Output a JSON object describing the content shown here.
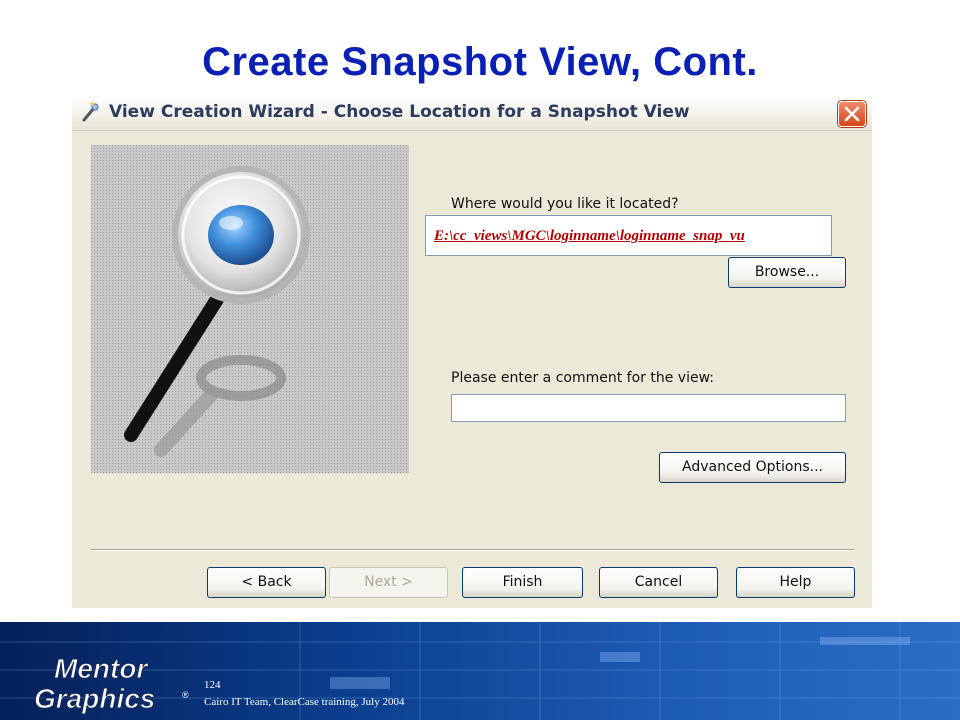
{
  "slide": {
    "title": "Create Snapshot View, Cont.",
    "page_number": "124",
    "footer_caption": "Cairo IT Team, ClearCase training, July 2004",
    "logo_text_line1": "Mentor",
    "logo_text_line2": "Graphics",
    "logo_mark": "®"
  },
  "window": {
    "title": "View Creation Wizard - Choose Location for a Snapshot View",
    "close_icon": "close-icon",
    "title_icon": "wizard-wand-icon"
  },
  "form": {
    "location_prompt": "Where would you like it located?",
    "location_value": "E:\\cc_views\\MGC\\loginname\\loginname_snap_vu",
    "browse_label": "Browse...",
    "comment_prompt": "Please enter a comment for the view:",
    "comment_value": "",
    "advanced_label": "Advanced Options..."
  },
  "buttons": {
    "back": "< Back",
    "next": "Next >",
    "finish": "Finish",
    "cancel": "Cancel",
    "help": "Help"
  },
  "colors": {
    "title": "#0a1fb4",
    "path_text": "#b00000",
    "dialog_bg": "#ece9d8",
    "footer_bg": "#0a3d8c"
  }
}
